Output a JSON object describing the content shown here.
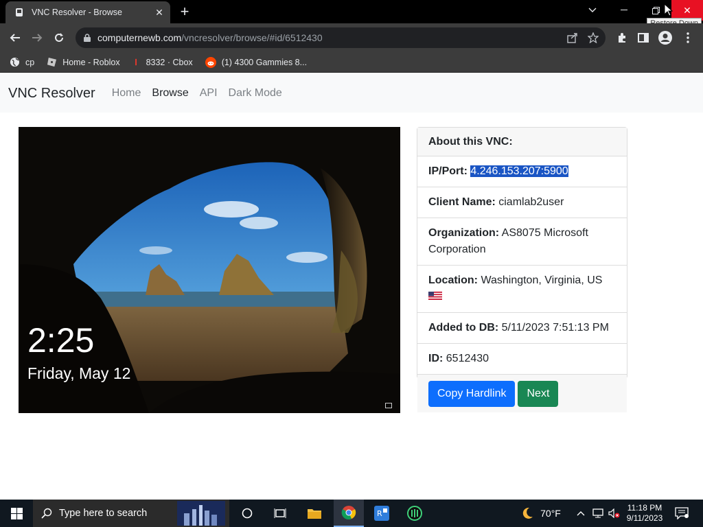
{
  "browser": {
    "tab_title": "VNC Resolver - Browse",
    "url_host": "computernewb.com",
    "url_path": "/vncresolver/browse/#id/6512430",
    "tooltip": "Restore Down",
    "bookmarks": [
      {
        "label": "cp",
        "icon": "globe-icon"
      },
      {
        "label": "Home - Roblox",
        "icon": "roblox-icon"
      },
      {
        "label": "8332 · Cbox",
        "icon": "cbox-icon"
      },
      {
        "label": "(1) 4300 Gammies 8...",
        "icon": "reddit-icon"
      }
    ]
  },
  "nav": {
    "brand": "VNC Resolver",
    "links": [
      "Home",
      "Browse",
      "API",
      "Dark Mode"
    ]
  },
  "screenshot": {
    "time": "2:25",
    "date": "Friday, May 12"
  },
  "card": {
    "header": "About this VNC:",
    "ip_label": "IP/Port:",
    "ip_value": "4.246.153.207:5900",
    "client_label": "Client Name:",
    "client_value": "ciamlab2user",
    "org_label": "Organization:",
    "org_value": "AS8075 Microsoft Corporation",
    "location_label": "Location:",
    "location_value": "Washington, Virginia, US",
    "added_label": "Added to DB:",
    "added_value": "5/11/2023 7:51:13 PM",
    "id_label": "ID:",
    "id_value": "6512430",
    "copy_button": "Copy Hardlink",
    "next_button": "Next"
  },
  "taskbar": {
    "search_placeholder": "Type here to search",
    "weather": "70°F",
    "time": "11:18 PM",
    "date": "9/11/2023"
  },
  "colors": {
    "primary": "#0d6efd",
    "success": "#198754",
    "highlight": "#1a55c4",
    "chrome_dark": "#3c3c3c"
  }
}
